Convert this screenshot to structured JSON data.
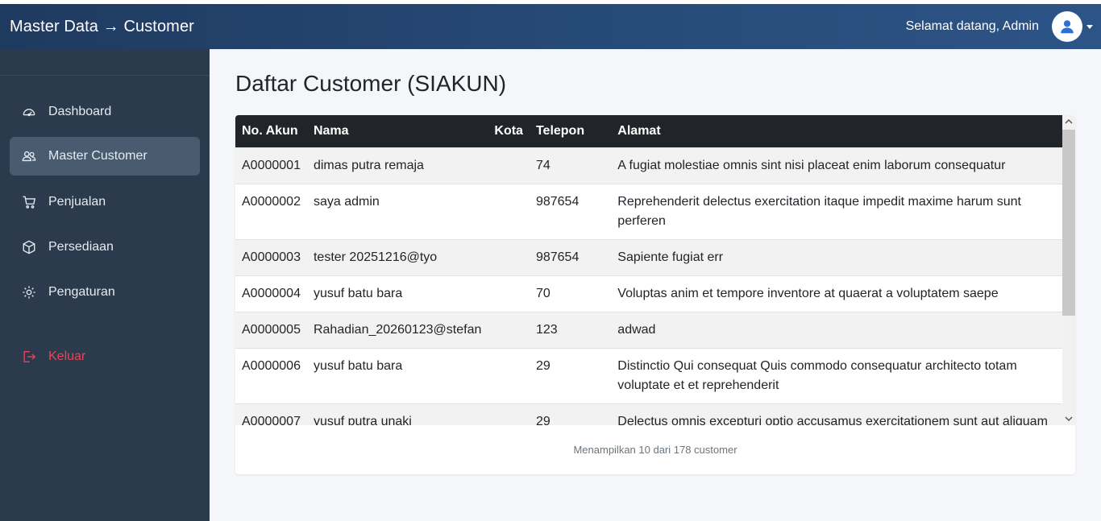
{
  "header": {
    "title": "Master Data → Customer",
    "welcome": "Selamat datang, Admin"
  },
  "sidebar": {
    "items": [
      {
        "label": "Dashboard",
        "icon": "gauge-icon"
      },
      {
        "label": "Master Customer",
        "icon": "users-icon",
        "active": true
      },
      {
        "label": "Penjualan",
        "icon": "cart-icon"
      },
      {
        "label": "Persediaan",
        "icon": "box-icon"
      },
      {
        "label": "Pengaturan",
        "icon": "gear-icon"
      }
    ],
    "logout": {
      "label": "Keluar",
      "icon": "logout-icon"
    }
  },
  "main": {
    "title": "Daftar Customer (SIAKUN)",
    "table": {
      "columns": [
        "No. Akun",
        "Nama",
        "Kota",
        "Telepon",
        "Alamat"
      ],
      "rows": [
        [
          "A0000001",
          "dimas putra remaja",
          "",
          "74",
          "A fugiat molestiae omnis sint nisi placeat enim laborum consequatur"
        ],
        [
          "A0000002",
          "saya admin",
          "",
          "987654",
          "Reprehenderit delectus exercitation itaque impedit maxime harum sunt perferen"
        ],
        [
          "A0000003",
          "tester 20251216@tyo",
          "",
          "987654",
          "Sapiente fugiat err"
        ],
        [
          "A0000004",
          "yusuf batu bara",
          "",
          "70",
          "Voluptas anim et tempore inventore at quaerat a voluptatem saepe"
        ],
        [
          "A0000005",
          "Rahadian_20260123@stefan",
          "",
          "123",
          "adwad"
        ],
        [
          "A0000006",
          "yusuf batu bara",
          "",
          "29",
          "Distinctio Qui consequat Quis commodo consequatur architecto totam voluptate et et reprehenderit"
        ],
        [
          "A0000007",
          "yusuf putra unaki",
          "",
          "29",
          "Delectus omnis excepturi optio accusamus exercitationem sunt aut aliquam sed optio in"
        ]
      ]
    },
    "footer": "Menampilkan 10 dari 178 customer"
  },
  "colors": {
    "topbar": "#274c7a",
    "sidebar": "#2b3a4d",
    "active_item": "#4a5b70",
    "logout": "#e0485a",
    "table_header": "#212529",
    "avatar_icon": "#2f6fd6"
  }
}
